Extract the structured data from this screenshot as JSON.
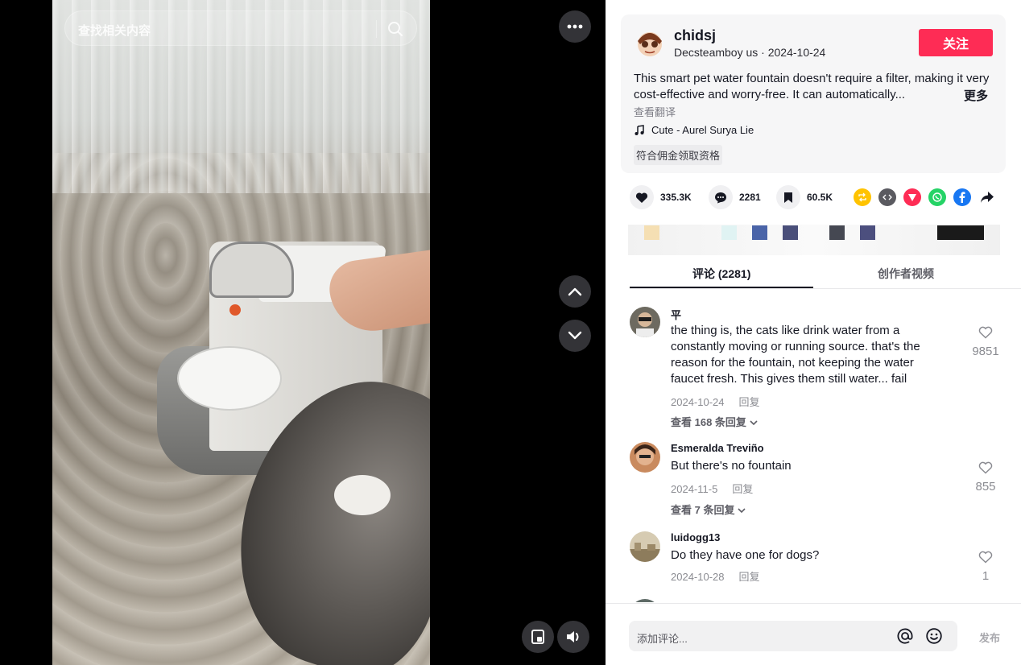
{
  "video": {
    "search_placeholder": "查找相关内容"
  },
  "author": {
    "name": "chidsj",
    "nickname": "Decsteamboy us",
    "separator": " · ",
    "date": "2024-10-24",
    "follow_label": "关注"
  },
  "post": {
    "description": "This smart pet water fountain doesn't require a filter, making it very cost-effective and worry-free. It can automatically...",
    "more_label": "更多",
    "translate_label": "查看翻译",
    "music": "Cute - Aurel Surya Lie",
    "commission_label": "符合佣金领取资格"
  },
  "actions": {
    "likes": "335.3K",
    "comments": "2281",
    "saves": "60.5K",
    "share_targets": [
      "repost-icon",
      "embed-icon",
      "send-icon",
      "whatsapp-icon",
      "facebook-icon",
      "share-arrow-icon"
    ]
  },
  "swatches": [
    "#f5dfb3",
    "#e0f3f3",
    "#4a64a8",
    "#4a4f7a",
    "#454852",
    "#4c4f7e",
    "#1a1a1a"
  ],
  "tabs": {
    "comments_label": "评论 (2281)",
    "creator_label": "创作者视频"
  },
  "comments": [
    {
      "name": "平",
      "text": "the thing is, the cats like drink water from a constantly moving or running source. that's the reason for the fountain, not keeping the water faucet fresh. This gives them still water... fail",
      "date": "2024-10-24",
      "reply_label": "回复",
      "view_replies": "查看 168 条回复",
      "likes": "9851"
    },
    {
      "name": "Esmeralda Treviño",
      "text": "But there's no fountain",
      "date": "2024-11-5",
      "reply_label": "回复",
      "view_replies": "查看 7 条回复",
      "likes": "855"
    },
    {
      "name": "luidogg13",
      "text": "Do they have one for dogs?",
      "date": "2024-10-28",
      "reply_label": "回复",
      "view_replies": "",
      "likes": "1"
    }
  ],
  "composer": {
    "placeholder": "添加评论...",
    "post_label": "发布"
  },
  "colors": {
    "accent": "#fe2c55",
    "text": "#161823",
    "muted": "#8a8b91"
  }
}
